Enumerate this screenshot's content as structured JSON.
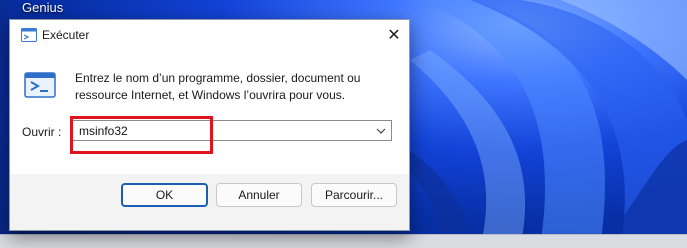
{
  "desktop": {
    "label": "Genius",
    "colors": {
      "wallpaper": "#1343d8"
    }
  },
  "dialog": {
    "title": "Exécuter",
    "close_label": "✕",
    "description": "Entrez le nom d’un programme, dossier, document ou ressource Internet, et Windows l’ouvrira pour vous.",
    "open_label": "Ouvrir :",
    "input_value": "msinfo32",
    "buttons": {
      "ok": "OK",
      "cancel": "Annuler",
      "browse": "Parcourir..."
    },
    "highlight_color": "#e0141e"
  }
}
